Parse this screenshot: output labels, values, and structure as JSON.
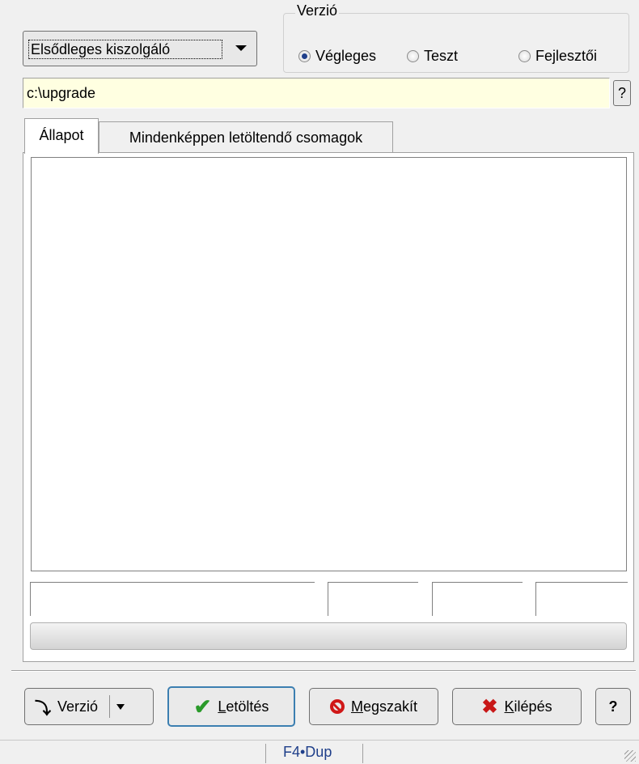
{
  "server": {
    "selected": "Elsődleges kiszolgáló"
  },
  "version_group": {
    "title": "Verzió",
    "options": [
      "Végleges",
      "Teszt",
      "Fejlesztői"
    ],
    "selected_index": 0
  },
  "path": {
    "value": "c:\\upgrade",
    "help_label": "?"
  },
  "tabs": [
    {
      "label": "Állapot",
      "active": true
    },
    {
      "label": "Mindenképpen letöltendő csomagok",
      "active": false
    }
  ],
  "buttons": {
    "version": "Verzió",
    "download": "Letöltés",
    "abort": "Megszakít",
    "exit": "Kilépés",
    "help": "?"
  },
  "statusbar": {
    "hint": "F4•Dup"
  },
  "colors": {
    "path_bg": "#ffffe1",
    "accent": "#1f3f8a"
  }
}
